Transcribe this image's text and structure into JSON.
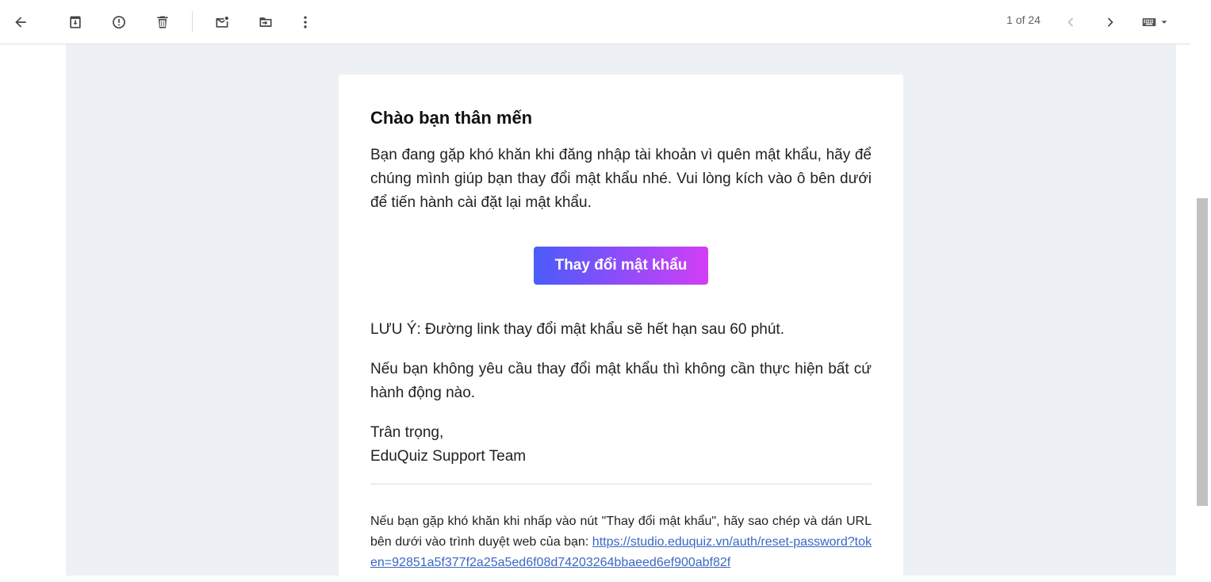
{
  "toolbar": {
    "icons": [
      "back-arrow-icon",
      "archive-icon",
      "report-spam-icon",
      "delete-icon",
      "mark-unread-icon",
      "move-to-icon",
      "more-icon"
    ],
    "pager_text": "1 of 24"
  },
  "email": {
    "greeting": "Chào bạn thân mến",
    "intro": "Bạn đang gặp khó khăn khi đăng nhập tài khoản vì quên mật khẩu, hãy để chúng mình giúp bạn thay đổi mật khẩu nhé. Vui lòng kích vào ô bên dưới để tiến hành cài đặt lại mật khẩu.",
    "button_label": "Thay đổi mật khẩu",
    "note": "LƯU Ý: Đường link thay đổi mật khẩu sẽ hết hạn sau 60 phút.",
    "no_request": "Nếu bạn không yêu cầu thay đổi mật khẩu thì không cần thực hiện bất cứ hành động nào.",
    "sign_off": "Trân trọng,",
    "sign_team": "EduQuiz Support Team",
    "footer_text": "Nếu bạn gặp khó khăn khi nhấp vào nút \"Thay đổi mật khẩu\", hãy sao chép và dán URL bên dưới vào trình duyệt web của bạn: ",
    "footer_link": "https://studio.eduquiz.vn/auth/reset-password?token=92851a5f377f2a25a5ed6f08d74203264bbaeed6ef900abf82f"
  },
  "colors": {
    "background": "#edf1f5",
    "button_gradient_start": "#4a5cfb",
    "button_gradient_end": "#d23ef6",
    "link": "#3a67c4"
  }
}
